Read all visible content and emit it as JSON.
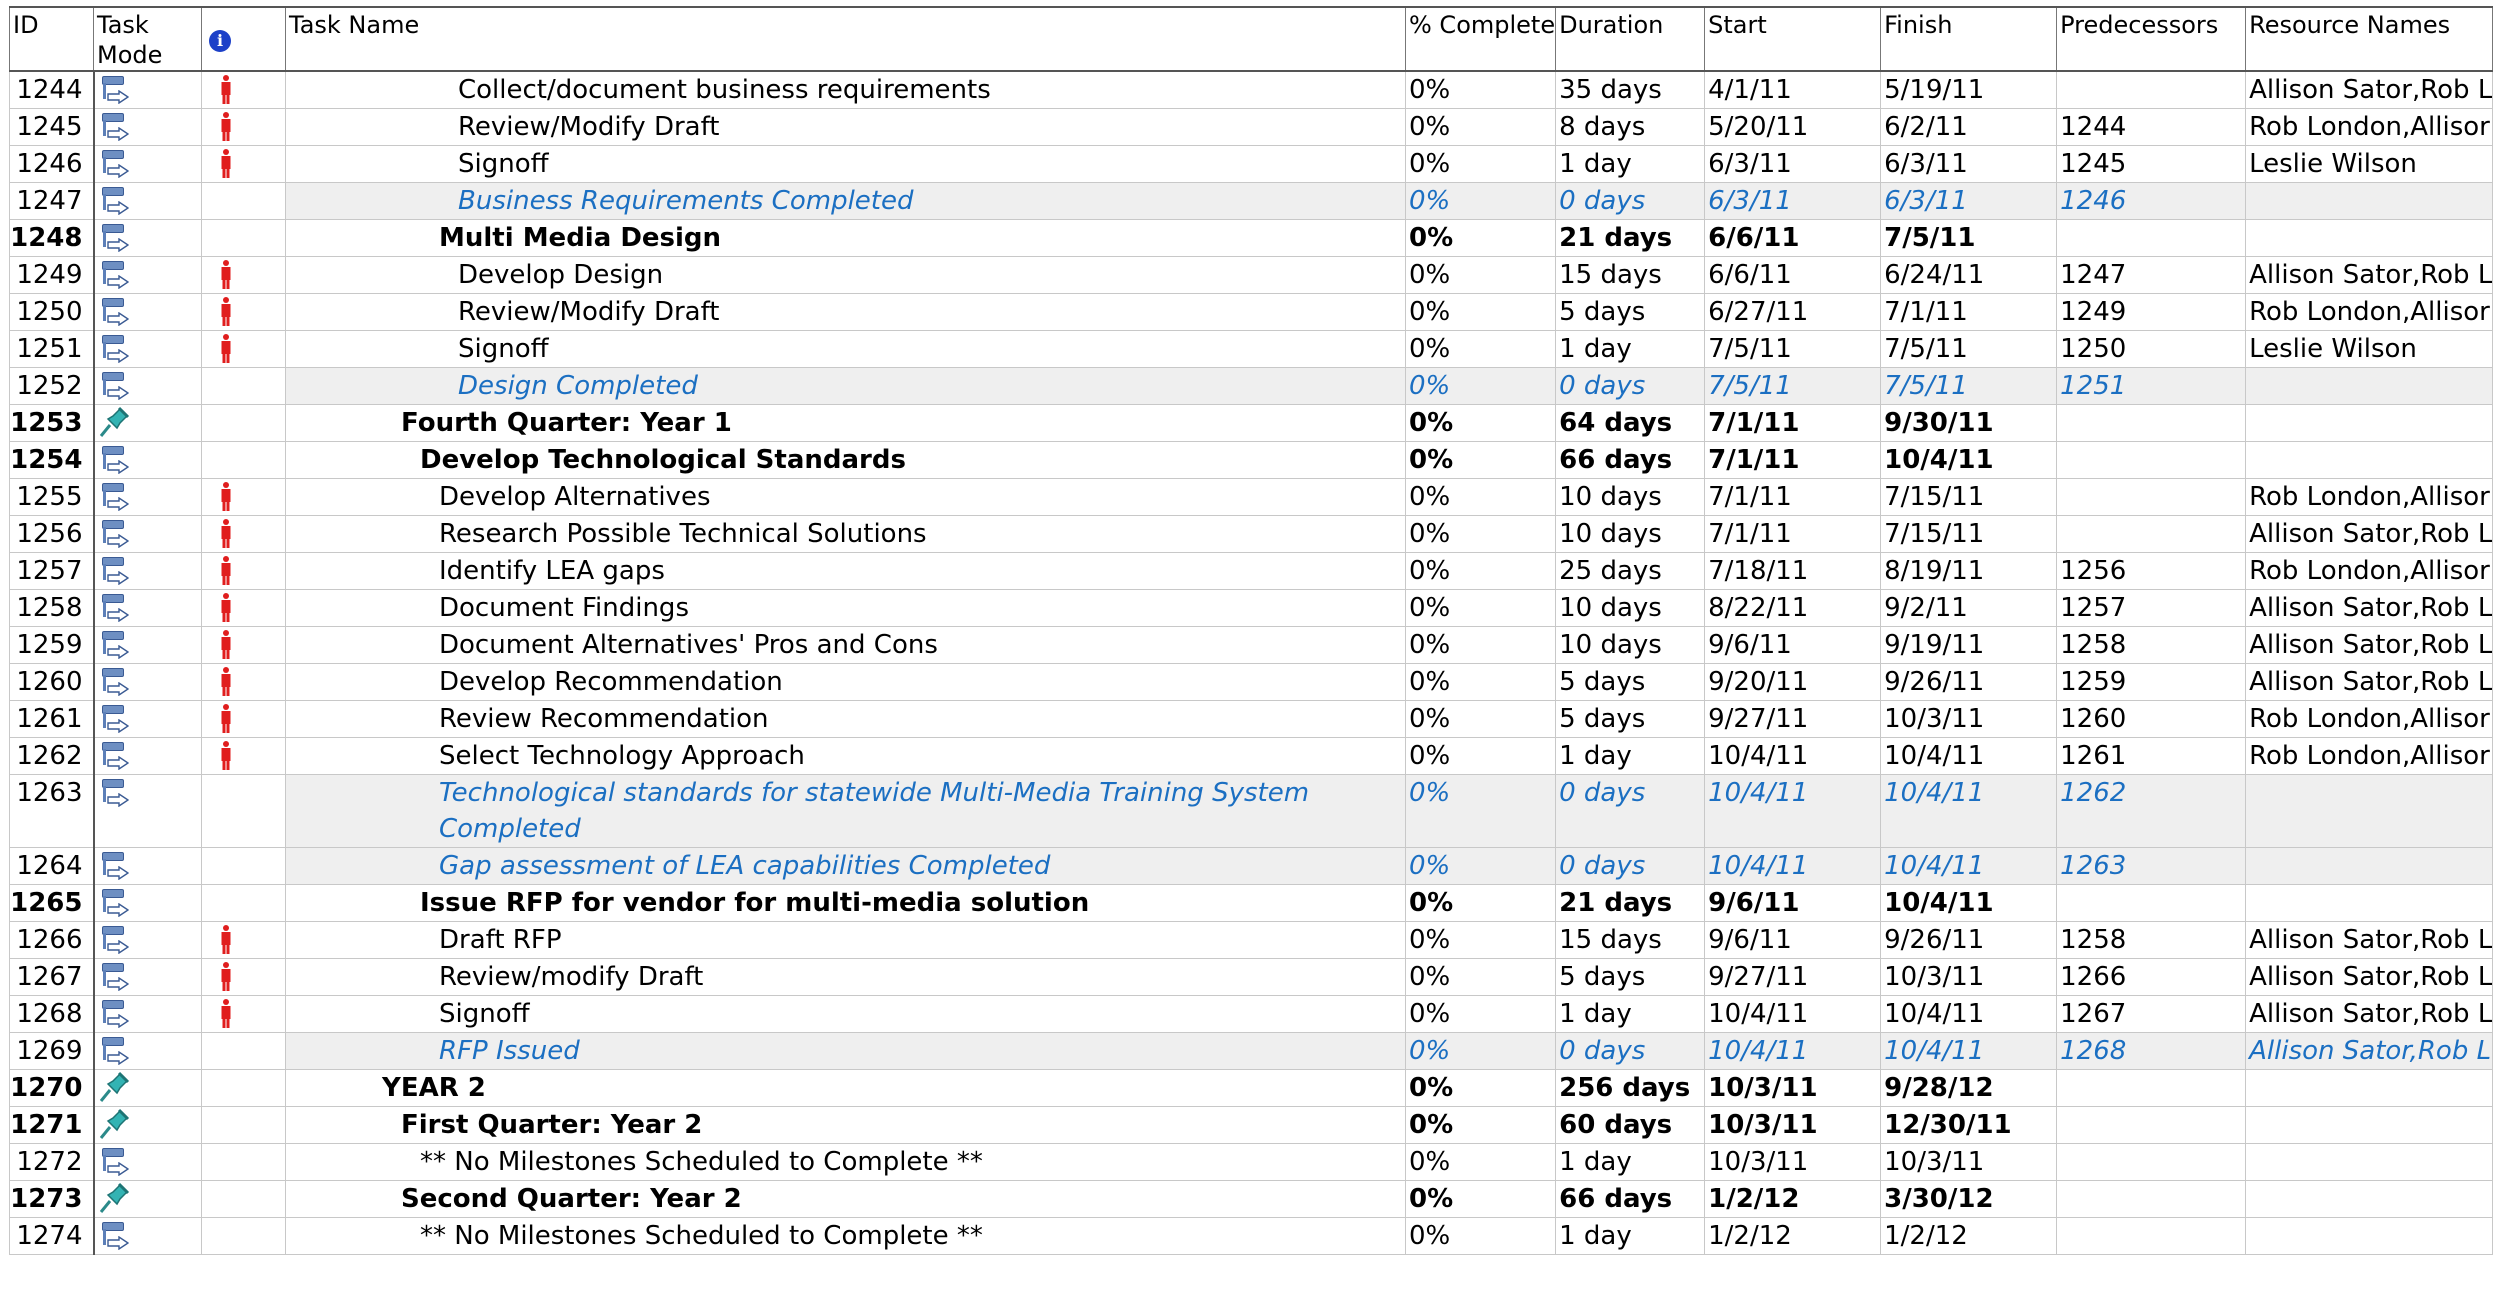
{
  "columns": {
    "id": "ID",
    "mode": "Task Mode",
    "indicators_icon": "info-icon",
    "name": "Task Name",
    "pct": "% Complete",
    "duration": "Duration",
    "start": "Start",
    "finish": "Finish",
    "pred": "Predecessors",
    "res": "Resource Names"
  },
  "colors": {
    "milestone_text": "#1b6fc2",
    "milestone_bg": "#efefef",
    "person_icon": "#e01e1e"
  },
  "rows": [
    {
      "id": "1244",
      "mode": "auto",
      "person": true,
      "level": 3,
      "type": "task",
      "name": "Collect/document business requirements",
      "pct": "0%",
      "dur": "35 days",
      "start": "4/1/11",
      "finish": "5/19/11",
      "pred": "",
      "res": "Allison Sator,Rob L"
    },
    {
      "id": "1245",
      "mode": "auto",
      "person": true,
      "level": 3,
      "type": "task",
      "name": "Review/Modify Draft",
      "pct": "0%",
      "dur": "8 days",
      "start": "5/20/11",
      "finish": "6/2/11",
      "pred": "1244",
      "res": "Rob London,Allisor"
    },
    {
      "id": "1246",
      "mode": "auto",
      "person": true,
      "level": 3,
      "type": "task",
      "name": "Signoff",
      "pct": "0%",
      "dur": "1 day",
      "start": "6/3/11",
      "finish": "6/3/11",
      "pred": "1245",
      "res": "Leslie Wilson"
    },
    {
      "id": "1247",
      "mode": "auto",
      "person": false,
      "level": 3,
      "type": "milestone",
      "name": "Business Requirements Completed",
      "pct": "0%",
      "dur": "0 days",
      "start": "6/3/11",
      "finish": "6/3/11",
      "pred": "1246",
      "res": ""
    },
    {
      "id": "1248",
      "mode": "auto",
      "person": false,
      "level": 2,
      "type": "summary",
      "name": "Multi Media Design",
      "pct": "0%",
      "dur": "21 days",
      "start": "6/6/11",
      "finish": "7/5/11",
      "pred": "",
      "res": ""
    },
    {
      "id": "1249",
      "mode": "auto",
      "person": true,
      "level": 3,
      "type": "task",
      "name": "Develop Design",
      "pct": "0%",
      "dur": "15 days",
      "start": "6/6/11",
      "finish": "6/24/11",
      "pred": "1247",
      "res": "Allison Sator,Rob L"
    },
    {
      "id": "1250",
      "mode": "auto",
      "person": true,
      "level": 3,
      "type": "task",
      "name": "Review/Modify Draft",
      "pct": "0%",
      "dur": "5 days",
      "start": "6/27/11",
      "finish": "7/1/11",
      "pred": "1249",
      "res": "Rob London,Allisor"
    },
    {
      "id": "1251",
      "mode": "auto",
      "person": true,
      "level": 3,
      "type": "task",
      "name": "Signoff",
      "pct": "0%",
      "dur": "1 day",
      "start": "7/5/11",
      "finish": "7/5/11",
      "pred": "1250",
      "res": "Leslie Wilson"
    },
    {
      "id": "1252",
      "mode": "auto",
      "person": false,
      "level": 3,
      "type": "milestone",
      "name": "Design Completed",
      "pct": "0%",
      "dur": "0 days",
      "start": "7/5/11",
      "finish": "7/5/11",
      "pred": "1251",
      "res": ""
    },
    {
      "id": "1253",
      "mode": "manual",
      "person": false,
      "level": 0,
      "type": "summary",
      "name": "Fourth Quarter: Year 1",
      "pct": "0%",
      "dur": "64 days",
      "start": "7/1/11",
      "finish": "9/30/11",
      "pred": "",
      "res": ""
    },
    {
      "id": "1254",
      "mode": "auto",
      "person": false,
      "level": 1,
      "type": "summary",
      "name": "Develop Technological Standards",
      "pct": "0%",
      "dur": "66 days",
      "start": "7/1/11",
      "finish": "10/4/11",
      "pred": "",
      "res": ""
    },
    {
      "id": "1255",
      "mode": "auto",
      "person": true,
      "level": 2,
      "type": "task",
      "name": "Develop Alternatives",
      "pct": "0%",
      "dur": "10 days",
      "start": "7/1/11",
      "finish": "7/15/11",
      "pred": "",
      "res": "Rob London,Allisor"
    },
    {
      "id": "1256",
      "mode": "auto",
      "person": true,
      "level": 2,
      "type": "task",
      "name": "Research Possible Technical Solutions",
      "pct": "0%",
      "dur": "10 days",
      "start": "7/1/11",
      "finish": "7/15/11",
      "pred": "",
      "res": "Allison Sator,Rob L"
    },
    {
      "id": "1257",
      "mode": "auto",
      "person": true,
      "level": 2,
      "type": "task",
      "name": "Identify LEA gaps",
      "pct": "0%",
      "dur": "25 days",
      "start": "7/18/11",
      "finish": "8/19/11",
      "pred": "1256",
      "res": "Rob London,Allisor"
    },
    {
      "id": "1258",
      "mode": "auto",
      "person": true,
      "level": 2,
      "type": "task",
      "name": "Document Findings",
      "pct": "0%",
      "dur": "10 days",
      "start": "8/22/11",
      "finish": "9/2/11",
      "pred": "1257",
      "res": "Allison Sator,Rob L"
    },
    {
      "id": "1259",
      "mode": "auto",
      "person": true,
      "level": 2,
      "type": "task",
      "name": "Document Alternatives' Pros and Cons",
      "pct": "0%",
      "dur": "10 days",
      "start": "9/6/11",
      "finish": "9/19/11",
      "pred": "1258",
      "res": "Allison Sator,Rob L"
    },
    {
      "id": "1260",
      "mode": "auto",
      "person": true,
      "level": 2,
      "type": "task",
      "name": "Develop Recommendation",
      "pct": "0%",
      "dur": "5 days",
      "start": "9/20/11",
      "finish": "9/26/11",
      "pred": "1259",
      "res": "Allison Sator,Rob L"
    },
    {
      "id": "1261",
      "mode": "auto",
      "person": true,
      "level": 2,
      "type": "task",
      "name": "Review Recommendation",
      "pct": "0%",
      "dur": "5 days",
      "start": "9/27/11",
      "finish": "10/3/11",
      "pred": "1260",
      "res": "Rob London,Allisor"
    },
    {
      "id": "1262",
      "mode": "auto",
      "person": true,
      "level": 2,
      "type": "task",
      "name": "Select Technology Approach",
      "pct": "0%",
      "dur": "1 day",
      "start": "10/4/11",
      "finish": "10/4/11",
      "pred": "1261",
      "res": "Rob London,Allisor"
    },
    {
      "id": "1263",
      "mode": "auto",
      "person": false,
      "level": 2,
      "type": "milestone",
      "tall": true,
      "name": "Technological standards for statewide Multi-Media Training System Completed",
      "pct": "0%",
      "dur": "0 days",
      "start": "10/4/11",
      "finish": "10/4/11",
      "pred": "1262",
      "res": ""
    },
    {
      "id": "1264",
      "mode": "auto",
      "person": false,
      "level": 2,
      "type": "milestone",
      "name": "Gap assessment of LEA capabilities Completed",
      "pct": "0%",
      "dur": "0 days",
      "start": "10/4/11",
      "finish": "10/4/11",
      "pred": "1263",
      "res": ""
    },
    {
      "id": "1265",
      "mode": "auto",
      "person": false,
      "level": 1,
      "type": "summary",
      "name": "Issue RFP for vendor for multi-media solution",
      "pct": "0%",
      "dur": "21 days",
      "start": "9/6/11",
      "finish": "10/4/11",
      "pred": "",
      "res": ""
    },
    {
      "id": "1266",
      "mode": "auto",
      "person": true,
      "level": 2,
      "type": "task",
      "name": "Draft RFP",
      "pct": "0%",
      "dur": "15 days",
      "start": "9/6/11",
      "finish": "9/26/11",
      "pred": "1258",
      "res": "Allison Sator,Rob L"
    },
    {
      "id": "1267",
      "mode": "auto",
      "person": true,
      "level": 2,
      "type": "task",
      "name": "Review/modify Draft",
      "pct": "0%",
      "dur": "5 days",
      "start": "9/27/11",
      "finish": "10/3/11",
      "pred": "1266",
      "res": "Allison Sator,Rob L"
    },
    {
      "id": "1268",
      "mode": "auto",
      "person": true,
      "level": 2,
      "type": "task",
      "name": "Signoff",
      "pct": "0%",
      "dur": "1 day",
      "start": "10/4/11",
      "finish": "10/4/11",
      "pred": "1267",
      "res": "Allison Sator,Rob L"
    },
    {
      "id": "1269",
      "mode": "auto",
      "person": false,
      "level": 2,
      "type": "milestone",
      "name": "RFP Issued",
      "pct": "0%",
      "dur": "0 days",
      "start": "10/4/11",
      "finish": "10/4/11",
      "pred": "1268",
      "res": "Allison Sator,Rob L"
    },
    {
      "id": "1270",
      "mode": "manual",
      "person": false,
      "level": -1,
      "type": "summary",
      "name": "YEAR 2",
      "pct": "0%",
      "dur": "256 days",
      "start": "10/3/11",
      "finish": "9/28/12",
      "pred": "",
      "res": ""
    },
    {
      "id": "1271",
      "mode": "manual",
      "person": false,
      "level": 0,
      "type": "summary",
      "name": "First Quarter: Year 2",
      "pct": "0%",
      "dur": "60 days",
      "start": "10/3/11",
      "finish": "12/30/11",
      "pred": "",
      "res": ""
    },
    {
      "id": "1272",
      "mode": "auto",
      "person": false,
      "level": 1,
      "type": "task",
      "name": "** No Milestones Scheduled to Complete **",
      "pct": "0%",
      "dur": "1 day",
      "start": "10/3/11",
      "finish": "10/3/11",
      "pred": "",
      "res": ""
    },
    {
      "id": "1273",
      "mode": "manual",
      "person": false,
      "level": 0,
      "type": "summary",
      "name": "Second Quarter: Year 2",
      "pct": "0%",
      "dur": "66 days",
      "start": "1/2/12",
      "finish": "3/30/12",
      "pred": "",
      "res": ""
    },
    {
      "id": "1274",
      "mode": "auto",
      "person": false,
      "level": 1,
      "type": "task",
      "name": "** No Milestones Scheduled to Complete **",
      "pct": "0%",
      "dur": "1 day",
      "start": "1/2/12",
      "finish": "1/2/12",
      "pred": "",
      "res": ""
    }
  ]
}
